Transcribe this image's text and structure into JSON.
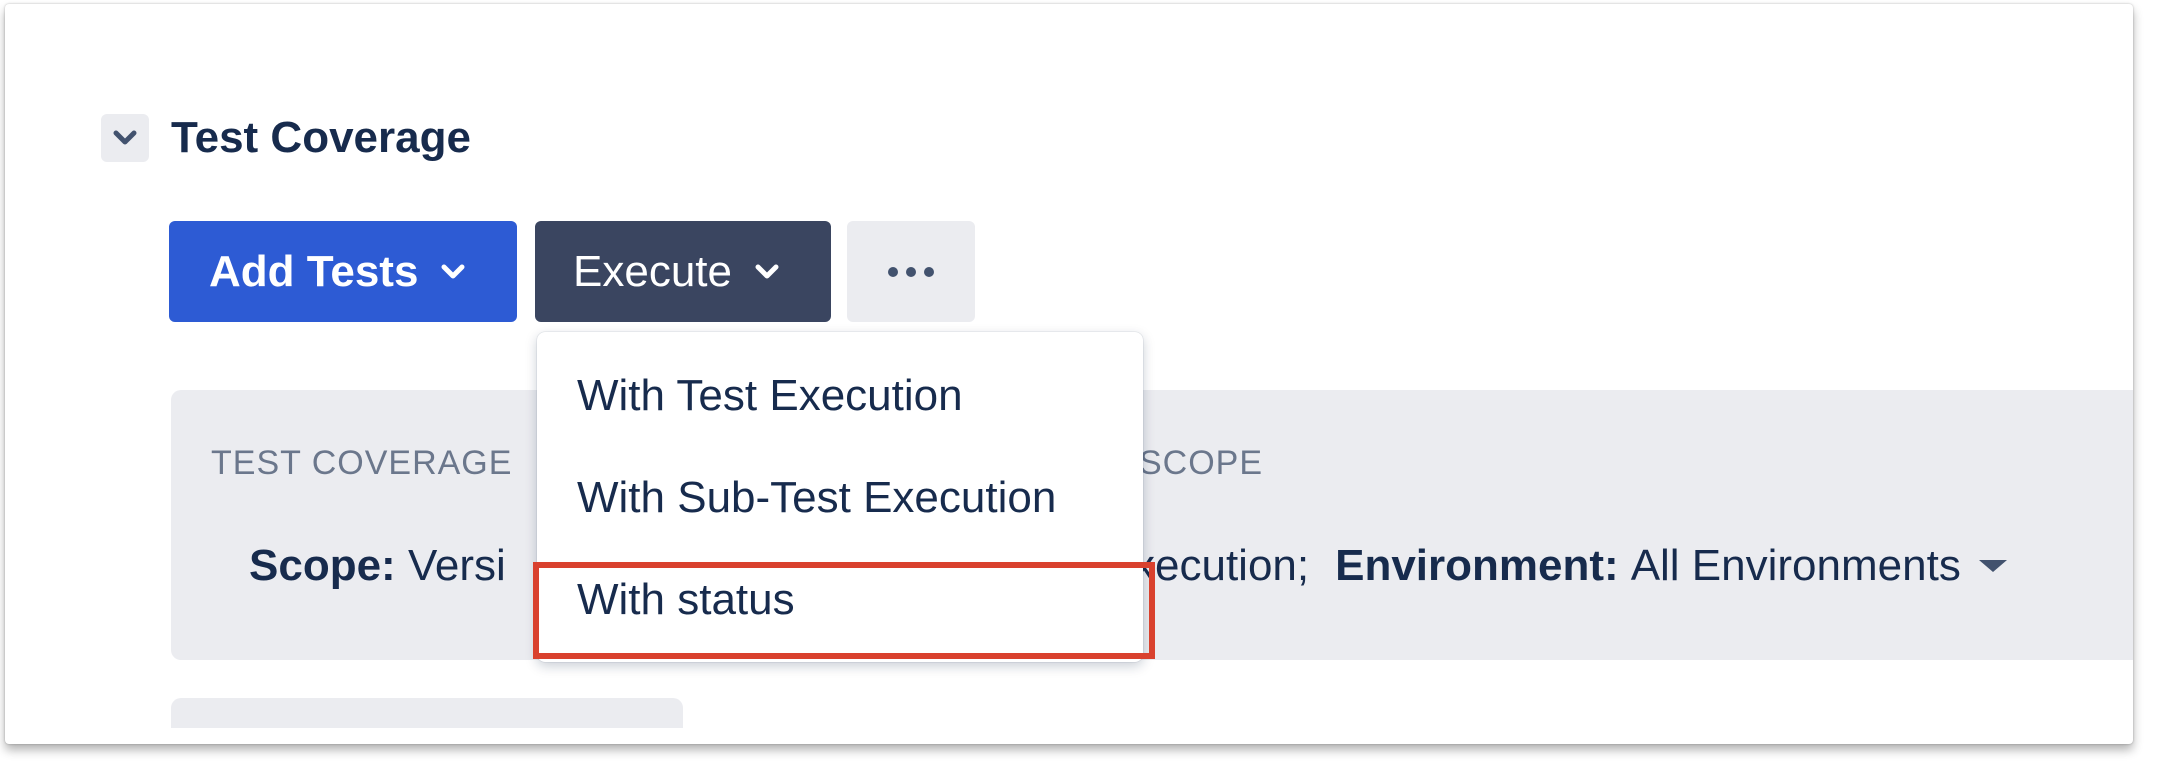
{
  "section": {
    "title": "Test Coverage",
    "toggle_icon": "chevron-down-icon"
  },
  "toolbar": {
    "add_tests_label": "Add Tests",
    "execute_label": "Execute",
    "more_icon": "more-horizontal-icon"
  },
  "panel": {
    "heading_left": "TEST COVERAGE",
    "heading_right": "SCOPE",
    "scope_label": "Scope:",
    "scope_value_visible": "Versi",
    "scope_tail_visible": "xecution;",
    "environment_label": "Environment:",
    "environment_value": "All Environments"
  },
  "execute_menu": {
    "items": [
      {
        "label": "With Test Execution"
      },
      {
        "label": "With Sub-Test Execution"
      },
      {
        "label": "With status"
      }
    ],
    "highlighted_index": 2
  },
  "colors": {
    "primary_button": "#2d5bd4",
    "execute_button": "#3a4560",
    "highlight_border": "#d9412e",
    "text": "#172b4d",
    "panel_bg": "#ebecf0"
  }
}
